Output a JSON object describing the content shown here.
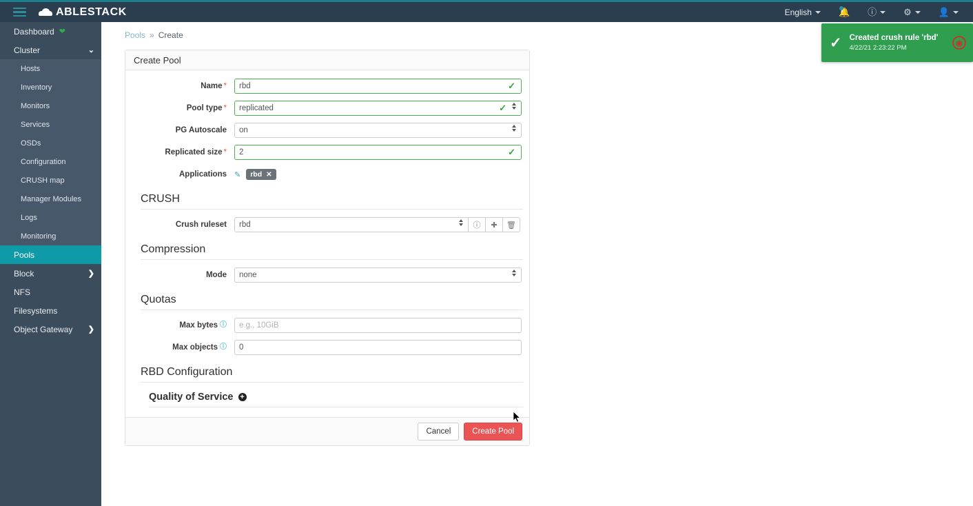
{
  "navbar": {
    "brand": "ABLESTACK",
    "menu_icon": "hamburger-icon",
    "language": "English",
    "notifications_icon": "bell-icon",
    "help_icon": "question-circle-icon",
    "settings_icon": "gear-icon",
    "user_icon": "user-icon",
    "background": "#2b3e50",
    "accent": "#1c7f8c"
  },
  "sidebar": {
    "background": "#3b4d5d",
    "active_color": "#0e9aa7",
    "items": [
      {
        "label": "Dashboard",
        "level": "top",
        "icon": "heart-icon",
        "active": false,
        "expandable": false
      },
      {
        "label": "Cluster",
        "level": "top",
        "icon": "chevron-down-icon",
        "active": false,
        "expandable": true
      },
      {
        "label": "Hosts",
        "level": "sub",
        "active": false,
        "expandable": false
      },
      {
        "label": "Inventory",
        "level": "sub",
        "active": false,
        "expandable": false
      },
      {
        "label": "Monitors",
        "level": "sub",
        "active": false,
        "expandable": false
      },
      {
        "label": "Services",
        "level": "sub",
        "active": false,
        "expandable": false
      },
      {
        "label": "OSDs",
        "level": "sub",
        "active": false,
        "expandable": false
      },
      {
        "label": "Configuration",
        "level": "sub",
        "active": false,
        "expandable": false
      },
      {
        "label": "CRUSH map",
        "level": "sub",
        "active": false,
        "expandable": false
      },
      {
        "label": "Manager Modules",
        "level": "sub",
        "active": false,
        "expandable": false
      },
      {
        "label": "Logs",
        "level": "sub",
        "active": false,
        "expandable": false
      },
      {
        "label": "Monitoring",
        "level": "sub",
        "active": false,
        "expandable": false
      },
      {
        "label": "Pools",
        "level": "top",
        "active": true,
        "expandable": false
      },
      {
        "label": "Block",
        "level": "top",
        "icon": "chevron-right-icon",
        "active": false,
        "expandable": true
      },
      {
        "label": "NFS",
        "level": "top",
        "active": false,
        "expandable": false
      },
      {
        "label": "Filesystems",
        "level": "top",
        "active": false,
        "expandable": false
      },
      {
        "label": "Object Gateway",
        "level": "top",
        "icon": "chevron-right-icon",
        "active": false,
        "expandable": true
      }
    ]
  },
  "breadcrumb": {
    "parent": "Pools",
    "separator": "»",
    "current": "Create"
  },
  "form": {
    "title": "Create Pool",
    "fields": {
      "name": {
        "label": "Name",
        "required": true,
        "value": "rbd",
        "valid": true
      },
      "pool_type": {
        "label": "Pool type",
        "required": true,
        "value": "replicated",
        "valid": true
      },
      "pg_autoscale": {
        "label": "PG Autoscale",
        "required": false,
        "value": "on",
        "valid": false
      },
      "replicated_size": {
        "label": "Replicated size",
        "required": true,
        "value": "2",
        "valid": true
      },
      "applications": {
        "label": "Applications",
        "required": false,
        "edit_icon": "pencil-icon",
        "badges": [
          {
            "label": "rbd",
            "remove": "✕"
          }
        ]
      }
    },
    "sections": {
      "crush": {
        "title": "CRUSH",
        "ruleset": {
          "label": "Crush ruleset",
          "value": "rbd",
          "buttons": [
            {
              "icon": "question-circle-icon",
              "glyph": "?"
            },
            {
              "icon": "plus-icon",
              "glyph": "＋"
            },
            {
              "icon": "trash-icon",
              "glyph": "🗑"
            }
          ]
        }
      },
      "compression": {
        "title": "Compression",
        "mode": {
          "label": "Mode",
          "value": "none"
        }
      },
      "quotas": {
        "title": "Quotas",
        "max_bytes": {
          "label": "Max bytes",
          "value": "",
          "placeholder": "e.g., 10GiB",
          "help_icon": "question-circle-icon"
        },
        "max_objects": {
          "label": "Max objects",
          "value": "0",
          "help_icon": "question-circle-icon"
        }
      },
      "rbd_configuration": {
        "title": "RBD Configuration",
        "quality_of_service": {
          "title": "Quality of Service",
          "expand_icon": "circle-plus-icon"
        }
      }
    },
    "footer": {
      "cancel_label": "Cancel",
      "submit_label": "Create Pool",
      "submit_color": "#ea5455"
    }
  },
  "toast": {
    "status_icon": "check-icon",
    "title": "Created crush rule 'rbd'",
    "timestamp": "4/22/21 2:23:22 PM",
    "type_icon": "broadcast-icon",
    "background": "#2f9e4f"
  }
}
